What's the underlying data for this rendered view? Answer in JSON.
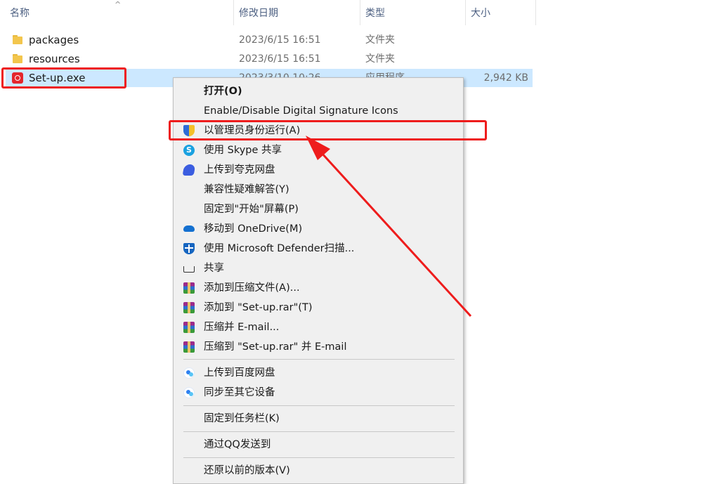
{
  "header": {
    "columns": [
      "名称",
      "修改日期",
      "类型",
      "大小"
    ],
    "sort_glyph": "^"
  },
  "files": [
    {
      "name": "packages",
      "date": "2023/6/15 16:51",
      "type": "文件夹",
      "size": "",
      "icon": "folder-icon"
    },
    {
      "name": "resources",
      "date": "2023/6/15 16:51",
      "type": "文件夹",
      "size": "",
      "icon": "folder-icon"
    },
    {
      "name": "Set-up.exe",
      "date": "2023/3/10 10:26",
      "type": "应用程序",
      "size": "2,942 KB",
      "icon": "adobe-exe-icon",
      "selected": true
    }
  ],
  "context_menu": {
    "items": [
      {
        "label": "打开(O)",
        "icon": ""
      },
      {
        "label": "Enable/Disable Digital Signature Icons",
        "icon": ""
      },
      {
        "label": "以管理员身份运行(A)",
        "icon": "uac-shield-icon"
      },
      {
        "label": "使用 Skype 共享",
        "icon": "skype-icon"
      },
      {
        "label": "上传到夸克网盘",
        "icon": "quark-cloud-icon"
      },
      {
        "label": "兼容性疑难解答(Y)",
        "icon": ""
      },
      {
        "label": "固定到\"开始\"屏幕(P)",
        "icon": ""
      },
      {
        "label": "移动到 OneDrive(M)",
        "icon": "onedrive-icon"
      },
      {
        "label": "使用 Microsoft Defender扫描...",
        "icon": "defender-icon"
      },
      {
        "label": "共享",
        "icon": "share-icon"
      },
      {
        "label": "添加到压缩文件(A)...",
        "icon": "winrar-icon"
      },
      {
        "label": "添加到 \"Set-up.rar\"(T)",
        "icon": "winrar-icon"
      },
      {
        "label": "压缩并 E-mail...",
        "icon": "winrar-icon"
      },
      {
        "label": "压缩到 \"Set-up.rar\" 并 E-mail",
        "icon": "winrar-icon"
      },
      {
        "label": "上传到百度网盘",
        "icon": "baidu-netdisk-icon"
      },
      {
        "label": "同步至其它设备",
        "icon": "baidu-netdisk-icon"
      },
      {
        "label": "固定到任务栏(K)",
        "icon": ""
      },
      {
        "label": "通过QQ发送到",
        "icon": ""
      },
      {
        "label": "还原以前的版本(V)",
        "icon": ""
      }
    ]
  },
  "annotation_color": "#ee1c1c"
}
